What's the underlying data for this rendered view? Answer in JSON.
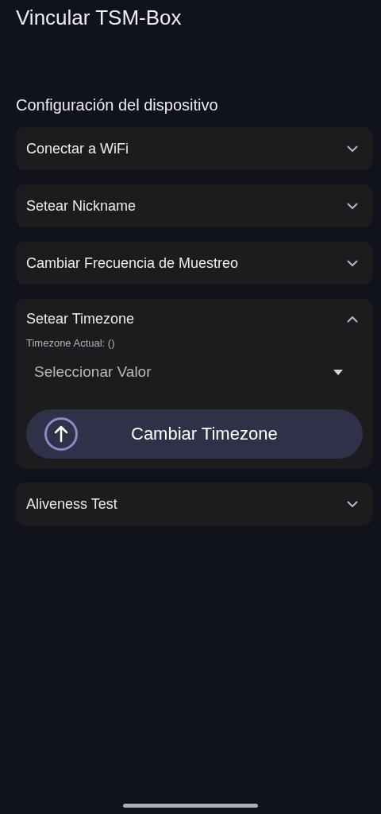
{
  "title": "Vincular TSM-Box",
  "section_title": "Configuración del dispositivo",
  "sections": [
    {
      "label": "Conectar a WiFi",
      "expanded": false
    },
    {
      "label": "Setear Nickname",
      "expanded": false
    },
    {
      "label": "Cambiar Frecuencia de Muestreo",
      "expanded": false
    },
    {
      "label": "Setear Timezone",
      "expanded": true,
      "content": {
        "current": "Timezone Actual: ()",
        "dropdown": {
          "placeholder": "Seleccionar Valor"
        },
        "button": "Cambiar Timezone"
      }
    },
    {
      "label": "Aliveness Test",
      "expanded": false
    }
  ]
}
